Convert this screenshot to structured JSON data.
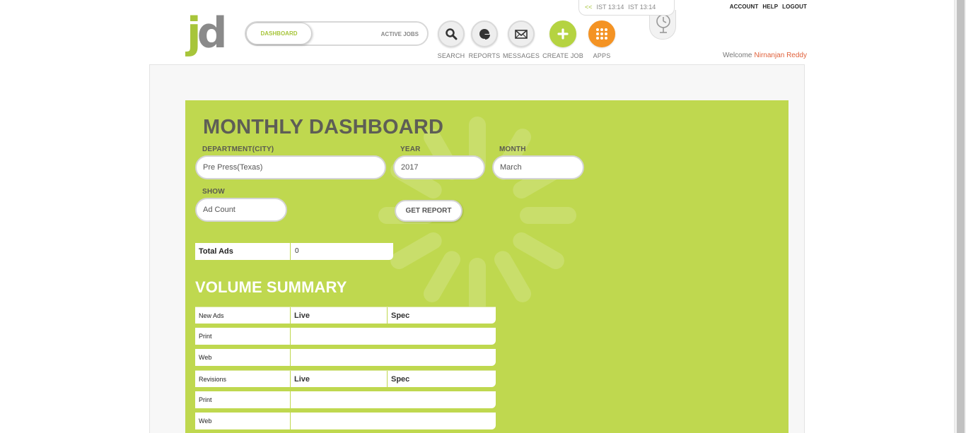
{
  "header": {
    "logo": {
      "j": "j",
      "d": "d"
    },
    "toggle": {
      "active": "DASHBOARD",
      "inactive": "ACTIVE JOBS"
    },
    "nav": [
      {
        "label": "SEARCH",
        "icon": "search-icon"
      },
      {
        "label": "REPORTS",
        "icon": "reports-icon"
      },
      {
        "label": "MESSAGES",
        "icon": "envelope-icon"
      },
      {
        "label": "CREATE JOB",
        "icon": "plus-icon"
      },
      {
        "label": "APPS",
        "icon": "grid-icon"
      }
    ],
    "clock": {
      "arrows": "<<",
      "time1": "IST 13:14",
      "time2": "IST 13:14"
    },
    "links": {
      "account": "ACCOUNT",
      "help": "HELP",
      "logout": "LOGOUT"
    },
    "welcome": {
      "prefix": "Welcome",
      "name": "Nirnanjan Reddy"
    }
  },
  "dashboard": {
    "title": "MONTHLY DASHBOARD",
    "department": {
      "label": "DEPARTMENT(CITY)",
      "value": "Pre Press(Texas)"
    },
    "year": {
      "label": "YEAR",
      "value": "2017"
    },
    "month": {
      "label": "MONTH",
      "value": "March"
    },
    "show": {
      "label": "SHOW",
      "value": "Ad Count"
    },
    "get_report": "GET REPORT",
    "total": {
      "label": "Total Ads",
      "value": "0"
    },
    "volume_title": "VOLUME SUMMARY",
    "volume_rows": [
      {
        "name": "New Ads",
        "live": "Live",
        "spec": "Spec",
        "head": true
      },
      {
        "name": "Print",
        "live": "",
        "spec": "",
        "head": false
      },
      {
        "name": "Web",
        "live": "",
        "spec": "",
        "head": false
      },
      {
        "name": "Revisions",
        "live": "Live",
        "spec": "Spec",
        "head": true
      },
      {
        "name": "Print",
        "live": "",
        "spec": "",
        "head": false
      },
      {
        "name": "Web",
        "live": "",
        "spec": "",
        "head": false
      }
    ]
  },
  "colors": {
    "panel": "#bfd84f",
    "accent_green": "#a7c53a",
    "accent_orange": "#f49324",
    "welcome_name": "#e0603a"
  }
}
